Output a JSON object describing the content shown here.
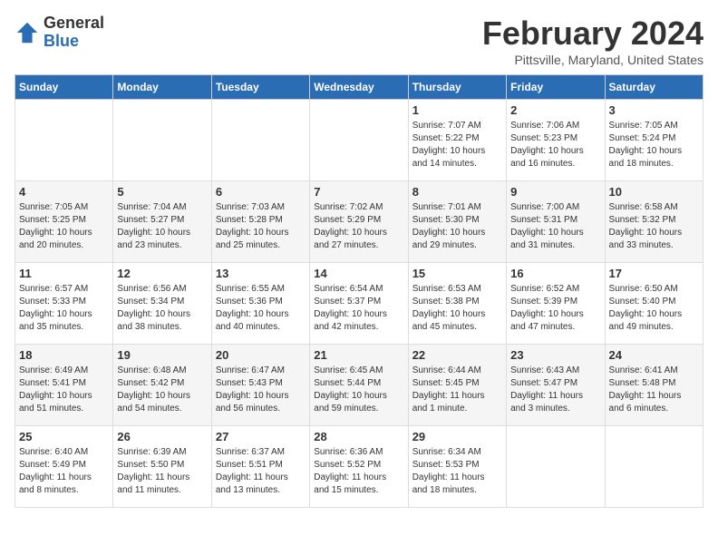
{
  "logo": {
    "general": "General",
    "blue": "Blue"
  },
  "title": "February 2024",
  "location": "Pittsville, Maryland, United States",
  "days_of_week": [
    "Sunday",
    "Monday",
    "Tuesday",
    "Wednesday",
    "Thursday",
    "Friday",
    "Saturday"
  ],
  "weeks": [
    [
      {
        "day": "",
        "content": ""
      },
      {
        "day": "",
        "content": ""
      },
      {
        "day": "",
        "content": ""
      },
      {
        "day": "",
        "content": ""
      },
      {
        "day": "1",
        "content": "Sunrise: 7:07 AM\nSunset: 5:22 PM\nDaylight: 10 hours\nand 14 minutes."
      },
      {
        "day": "2",
        "content": "Sunrise: 7:06 AM\nSunset: 5:23 PM\nDaylight: 10 hours\nand 16 minutes."
      },
      {
        "day": "3",
        "content": "Sunrise: 7:05 AM\nSunset: 5:24 PM\nDaylight: 10 hours\nand 18 minutes."
      }
    ],
    [
      {
        "day": "4",
        "content": "Sunrise: 7:05 AM\nSunset: 5:25 PM\nDaylight: 10 hours\nand 20 minutes."
      },
      {
        "day": "5",
        "content": "Sunrise: 7:04 AM\nSunset: 5:27 PM\nDaylight: 10 hours\nand 23 minutes."
      },
      {
        "day": "6",
        "content": "Sunrise: 7:03 AM\nSunset: 5:28 PM\nDaylight: 10 hours\nand 25 minutes."
      },
      {
        "day": "7",
        "content": "Sunrise: 7:02 AM\nSunset: 5:29 PM\nDaylight: 10 hours\nand 27 minutes."
      },
      {
        "day": "8",
        "content": "Sunrise: 7:01 AM\nSunset: 5:30 PM\nDaylight: 10 hours\nand 29 minutes."
      },
      {
        "day": "9",
        "content": "Sunrise: 7:00 AM\nSunset: 5:31 PM\nDaylight: 10 hours\nand 31 minutes."
      },
      {
        "day": "10",
        "content": "Sunrise: 6:58 AM\nSunset: 5:32 PM\nDaylight: 10 hours\nand 33 minutes."
      }
    ],
    [
      {
        "day": "11",
        "content": "Sunrise: 6:57 AM\nSunset: 5:33 PM\nDaylight: 10 hours\nand 35 minutes."
      },
      {
        "day": "12",
        "content": "Sunrise: 6:56 AM\nSunset: 5:34 PM\nDaylight: 10 hours\nand 38 minutes."
      },
      {
        "day": "13",
        "content": "Sunrise: 6:55 AM\nSunset: 5:36 PM\nDaylight: 10 hours\nand 40 minutes."
      },
      {
        "day": "14",
        "content": "Sunrise: 6:54 AM\nSunset: 5:37 PM\nDaylight: 10 hours\nand 42 minutes."
      },
      {
        "day": "15",
        "content": "Sunrise: 6:53 AM\nSunset: 5:38 PM\nDaylight: 10 hours\nand 45 minutes."
      },
      {
        "day": "16",
        "content": "Sunrise: 6:52 AM\nSunset: 5:39 PM\nDaylight: 10 hours\nand 47 minutes."
      },
      {
        "day": "17",
        "content": "Sunrise: 6:50 AM\nSunset: 5:40 PM\nDaylight: 10 hours\nand 49 minutes."
      }
    ],
    [
      {
        "day": "18",
        "content": "Sunrise: 6:49 AM\nSunset: 5:41 PM\nDaylight: 10 hours\nand 51 minutes."
      },
      {
        "day": "19",
        "content": "Sunrise: 6:48 AM\nSunset: 5:42 PM\nDaylight: 10 hours\nand 54 minutes."
      },
      {
        "day": "20",
        "content": "Sunrise: 6:47 AM\nSunset: 5:43 PM\nDaylight: 10 hours\nand 56 minutes."
      },
      {
        "day": "21",
        "content": "Sunrise: 6:45 AM\nSunset: 5:44 PM\nDaylight: 10 hours\nand 59 minutes."
      },
      {
        "day": "22",
        "content": "Sunrise: 6:44 AM\nSunset: 5:45 PM\nDaylight: 11 hours\nand 1 minute."
      },
      {
        "day": "23",
        "content": "Sunrise: 6:43 AM\nSunset: 5:47 PM\nDaylight: 11 hours\nand 3 minutes."
      },
      {
        "day": "24",
        "content": "Sunrise: 6:41 AM\nSunset: 5:48 PM\nDaylight: 11 hours\nand 6 minutes."
      }
    ],
    [
      {
        "day": "25",
        "content": "Sunrise: 6:40 AM\nSunset: 5:49 PM\nDaylight: 11 hours\nand 8 minutes."
      },
      {
        "day": "26",
        "content": "Sunrise: 6:39 AM\nSunset: 5:50 PM\nDaylight: 11 hours\nand 11 minutes."
      },
      {
        "day": "27",
        "content": "Sunrise: 6:37 AM\nSunset: 5:51 PM\nDaylight: 11 hours\nand 13 minutes."
      },
      {
        "day": "28",
        "content": "Sunrise: 6:36 AM\nSunset: 5:52 PM\nDaylight: 11 hours\nand 15 minutes."
      },
      {
        "day": "29",
        "content": "Sunrise: 6:34 AM\nSunset: 5:53 PM\nDaylight: 11 hours\nand 18 minutes."
      },
      {
        "day": "",
        "content": ""
      },
      {
        "day": "",
        "content": ""
      }
    ]
  ]
}
